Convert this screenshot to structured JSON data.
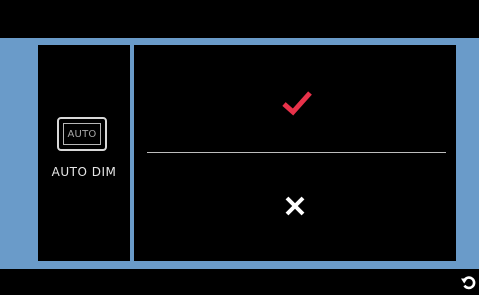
{
  "setting": {
    "icon_text": "AUTO",
    "label": "AUTO DIM"
  },
  "options": {
    "confirm_icon": "check-icon",
    "cancel_icon": "cross-icon"
  },
  "navigation": {
    "back_icon": "back-arrow-icon"
  },
  "colors": {
    "frame": "#6a9bc9",
    "check": "#e8324a",
    "cross": "#ffffff",
    "background": "#000000"
  }
}
